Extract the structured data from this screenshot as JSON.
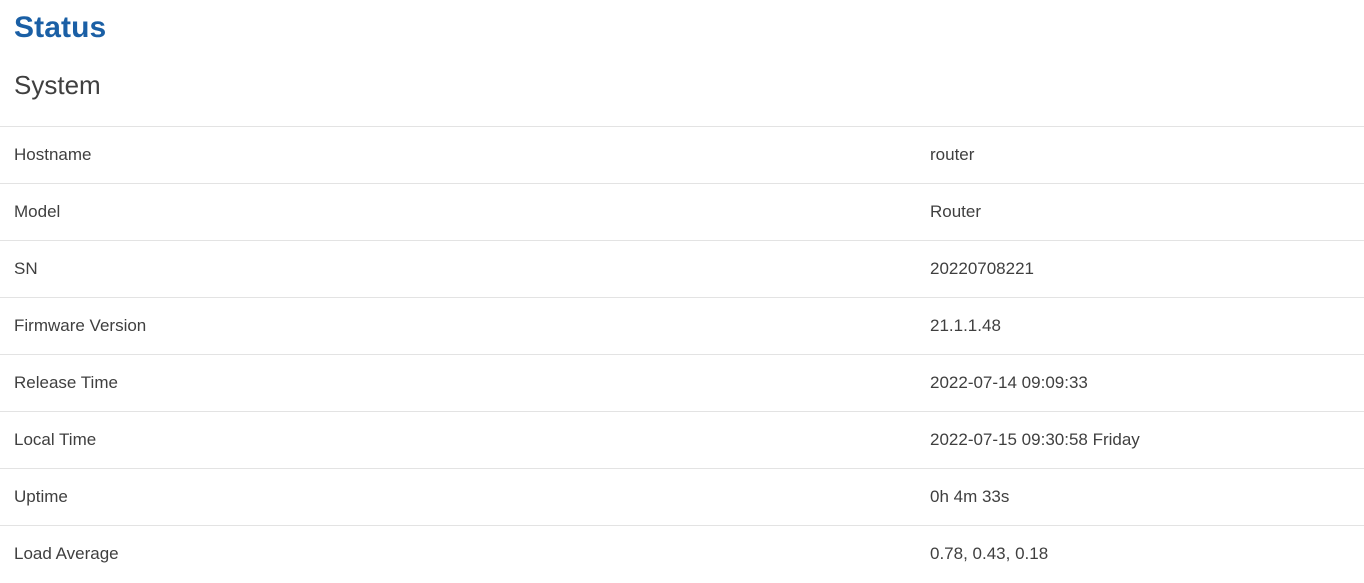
{
  "page": {
    "title": "Status",
    "section_title": "System",
    "accent_color": "#1a5fa5",
    "text_color": "#3f3f3f",
    "divider_color": "#e3e3e3",
    "background_color": "#ffffff"
  },
  "system_table": {
    "rows": [
      {
        "label": "Hostname",
        "value": "router"
      },
      {
        "label": "Model",
        "value": "Router"
      },
      {
        "label": "SN",
        "value": "20220708221"
      },
      {
        "label": "Firmware Version",
        "value": "21.1.1.48"
      },
      {
        "label": "Release Time",
        "value": "2022-07-14 09:09:33"
      },
      {
        "label": "Local Time",
        "value": "2022-07-15 09:30:58 Friday"
      },
      {
        "label": "Uptime",
        "value": "0h 4m 33s"
      },
      {
        "label": "Load Average",
        "value": "0.78, 0.43, 0.18"
      }
    ]
  }
}
